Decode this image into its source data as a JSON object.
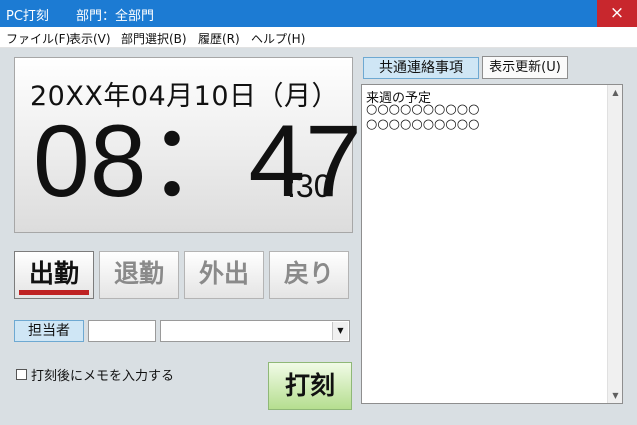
{
  "window": {
    "title": "PC打刻",
    "department_title": "部門：全部門",
    "close_glyph": "×"
  },
  "menu": [
    {
      "label": "ファイル(F)"
    },
    {
      "label": "表示(V)"
    },
    {
      "label": "部門選択(B)"
    },
    {
      "label": "履歴(R)"
    },
    {
      "label": "ヘルプ(H)"
    }
  ],
  "clock": {
    "date": "20XX年04月10日（月）",
    "time": "08：47",
    "seconds": ":30"
  },
  "punch_buttons": [
    {
      "label": "出勤",
      "state": "selected"
    },
    {
      "label": "退勤",
      "state": "normal"
    },
    {
      "label": "外出",
      "state": "normal"
    },
    {
      "label": "戻り",
      "state": "normal"
    }
  ],
  "person": {
    "label": "担当者",
    "code_value": "",
    "name_value": "",
    "dropdown_icon": "▼"
  },
  "memo": {
    "label": "打刻後にメモを入力する",
    "checked": false
  },
  "stamp_button": {
    "label": "打刻"
  },
  "notice": {
    "header": "共通連絡事項",
    "refresh_label": "表示更新(U)",
    "lines": [
      "来週の予定",
      "○○○○○○○○○○",
      "○○○○○○○○○○"
    ],
    "scroll_up_icon": "▲",
    "scroll_down_icon": "▼"
  },
  "colors": {
    "titlebar": "#1c7bd3",
    "close_button": "#c8272d",
    "selected_indicator": "#bf2222",
    "stamp_button": "#b5de8f",
    "label_box": "#cfe6f5"
  }
}
